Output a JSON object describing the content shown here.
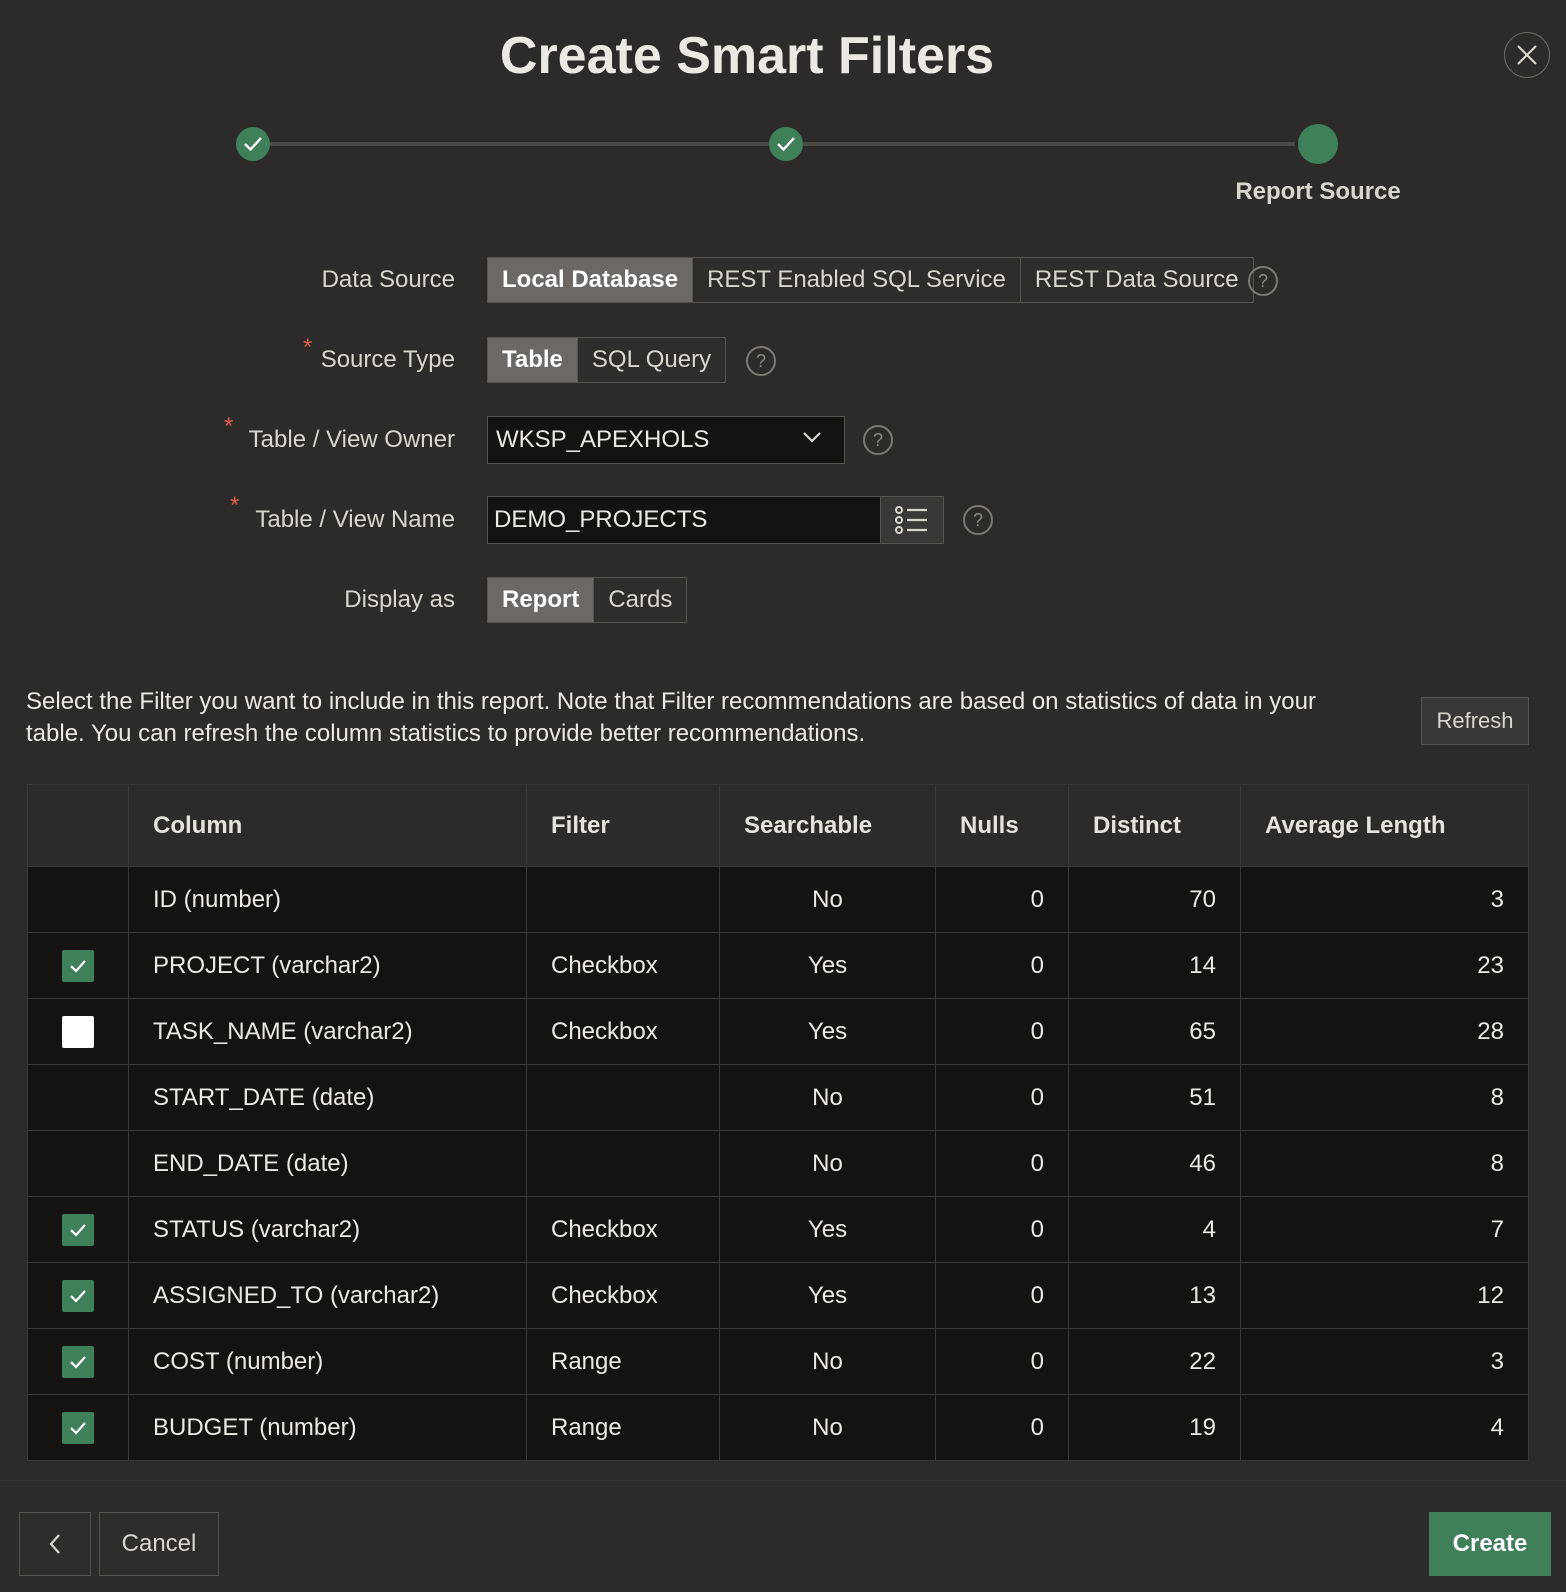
{
  "dialog": {
    "title": "Create Smart Filters"
  },
  "wizard": {
    "current_step_label": "Report Source"
  },
  "form": {
    "data_source": {
      "label": "Data Source",
      "options": [
        "Local Database",
        "REST Enabled SQL Service",
        "REST Data Source"
      ],
      "selected": "Local Database"
    },
    "source_type": {
      "label": "Source Type",
      "required_mark": "*",
      "options": [
        "Table",
        "SQL Query"
      ],
      "selected": "Table"
    },
    "owner": {
      "label": "Table / View Owner",
      "required_mark": "*",
      "value": "WKSP_APEXHOLS"
    },
    "table_name": {
      "label": "Table / View Name",
      "required_mark": "*",
      "value": "DEMO_PROJECTS"
    },
    "display_as": {
      "label": "Display as",
      "options": [
        "Report",
        "Cards"
      ],
      "selected": "Report"
    },
    "help_glyph": "?"
  },
  "info": {
    "text": "Select the Filter you want to include in this report. Note that Filter recommendations are based on statistics of data in your table. You can refresh the column statistics to provide better recommendations.",
    "refresh_label": "Refresh"
  },
  "table": {
    "headers": [
      "",
      "Column",
      "Filter",
      "Searchable",
      "Nulls",
      "Distinct",
      "Average Length"
    ],
    "rows": [
      {
        "checkbox": "none",
        "column": "ID (number)",
        "filter": "",
        "searchable": "No",
        "nulls": "0",
        "distinct": "70",
        "avg_length": "3"
      },
      {
        "checkbox": "checked",
        "column": "PROJECT (varchar2)",
        "filter": "Checkbox",
        "searchable": "Yes",
        "nulls": "0",
        "distinct": "14",
        "avg_length": "23"
      },
      {
        "checkbox": "unchecked",
        "column": "TASK_NAME (varchar2)",
        "filter": "Checkbox",
        "searchable": "Yes",
        "nulls": "0",
        "distinct": "65",
        "avg_length": "28"
      },
      {
        "checkbox": "none",
        "column": "START_DATE (date)",
        "filter": "",
        "searchable": "No",
        "nulls": "0",
        "distinct": "51",
        "avg_length": "8"
      },
      {
        "checkbox": "none",
        "column": "END_DATE (date)",
        "filter": "",
        "searchable": "No",
        "nulls": "0",
        "distinct": "46",
        "avg_length": "8"
      },
      {
        "checkbox": "checked",
        "column": "STATUS (varchar2)",
        "filter": "Checkbox",
        "searchable": "Yes",
        "nulls": "0",
        "distinct": "4",
        "avg_length": "7"
      },
      {
        "checkbox": "checked",
        "column": "ASSIGNED_TO (varchar2)",
        "filter": "Checkbox",
        "searchable": "Yes",
        "nulls": "0",
        "distinct": "13",
        "avg_length": "12"
      },
      {
        "checkbox": "checked",
        "column": "COST (number)",
        "filter": "Range",
        "searchable": "No",
        "nulls": "0",
        "distinct": "22",
        "avg_length": "3"
      },
      {
        "checkbox": "checked",
        "column": "BUDGET (number)",
        "filter": "Range",
        "searchable": "No",
        "nulls": "0",
        "distinct": "19",
        "avg_length": "4"
      }
    ]
  },
  "footer": {
    "back_icon": "chevron-left-icon",
    "cancel_label": "Cancel",
    "create_label": "Create"
  },
  "colors": {
    "accent": "#3f7f59",
    "background": "#2d2b29",
    "grid_cell": "#141312",
    "required": "#d8604a"
  }
}
